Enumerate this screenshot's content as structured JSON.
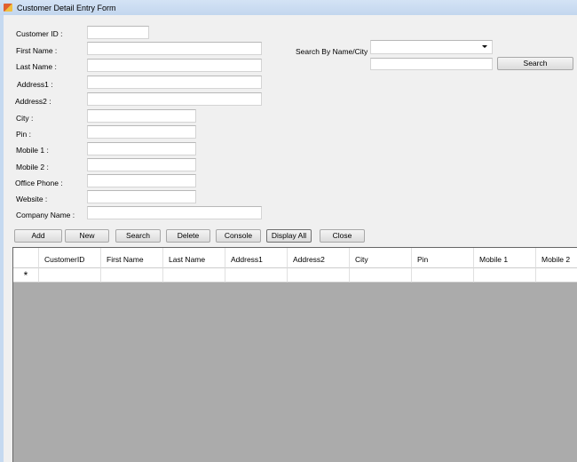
{
  "window": {
    "title": "Customer Detail Entry Form"
  },
  "form": {
    "customer_id": "Customer ID :",
    "first_name": "First Name :",
    "last_name": "Last Name :",
    "address1": "Address1 :",
    "address2": "Address2 :",
    "city": "City :",
    "pin": "Pin :",
    "mobile1": "Mobile 1 :",
    "mobile2": "Mobile 2 :",
    "office_phone": "Office Phone :",
    "website": "Website :",
    "company_name": "Company Name :"
  },
  "search": {
    "label": "Search By Name/City :",
    "combo_value": "",
    "text_value": "",
    "button": "Search"
  },
  "buttons": {
    "add": "Add",
    "new": "New",
    "search": "Search",
    "delete": "Delete",
    "console": "Console",
    "display_all": "Display All",
    "close": "Close"
  },
  "grid": {
    "columns": [
      "CustomerID",
      "First Name",
      "Last Name",
      "Address1",
      "Address2",
      "City",
      "Pin",
      "Mobile 1",
      "Mobile 2"
    ],
    "new_row_marker": "*"
  }
}
